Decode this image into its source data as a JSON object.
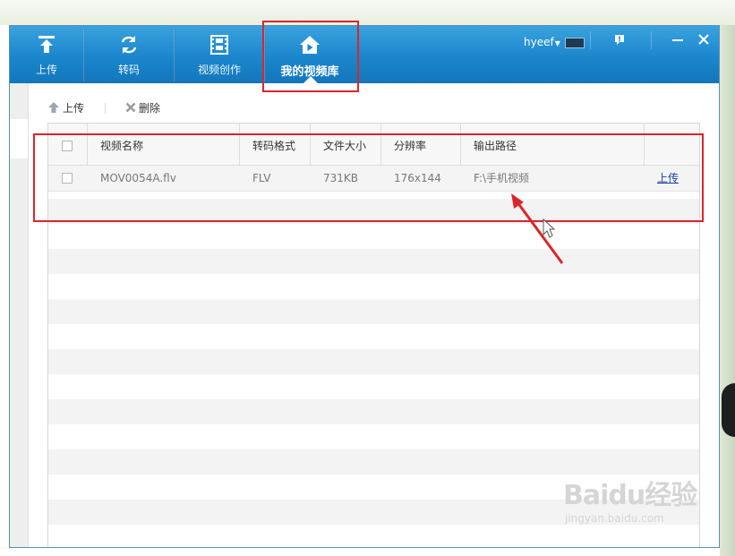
{
  "window": {
    "nav": [
      {
        "label": "上传",
        "icon": "upload-icon"
      },
      {
        "label": "转码",
        "icon": "convert-icon"
      },
      {
        "label": "视频创作",
        "icon": "film-icon"
      },
      {
        "label": "我的视频库",
        "icon": "home-icon",
        "active": true
      }
    ],
    "user": {
      "name": "hyeef"
    },
    "controls": [
      "alert-icon",
      "minimize-icon",
      "close-icon"
    ]
  },
  "toolbar": {
    "upload_label": "上传",
    "delete_label": "删除"
  },
  "table": {
    "columns": [
      "视频名称",
      "转码格式",
      "文件大小",
      "分辨率",
      "输出路径"
    ],
    "rows": [
      {
        "name": "MOV0054A.flv",
        "format": "FLV",
        "size": "731KB",
        "resolution": "176x144",
        "path": "F:\\手机视频",
        "action": "上传"
      }
    ]
  },
  "watermark": {
    "logo": "Baidu经验",
    "site": "jingyan.baidu.com"
  },
  "colors": {
    "titlebar": "#1b86cc",
    "highlight": "#d9262b",
    "link": "#1a3f9c"
  }
}
